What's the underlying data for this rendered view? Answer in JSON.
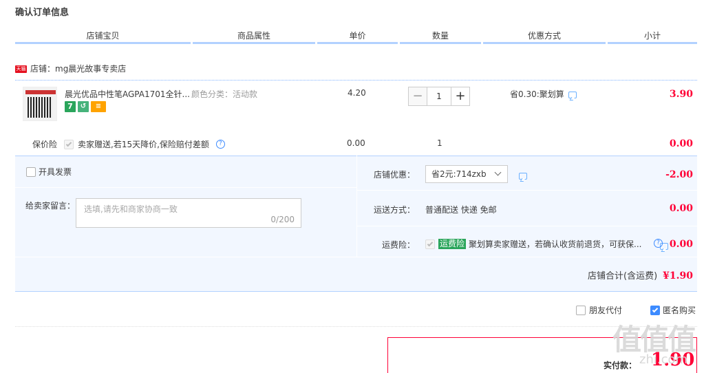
{
  "page_title": "确认订单信息",
  "columns": [
    "店铺宝贝",
    "商品属性",
    "单价",
    "数量",
    "优惠方式",
    "小计"
  ],
  "shop": {
    "tmall_label": "天猫",
    "name": "店铺：mg晨光故事专卖店"
  },
  "item": {
    "name": "晨光优品中性笔AGPA1701全针...",
    "attr": "颜色分类：活动款",
    "price": "4.20",
    "quantity": "1",
    "discount": "省0.30:聚划算",
    "subtotal": "3.90",
    "badges": [
      "7",
      "↺",
      "≡"
    ]
  },
  "insurance": {
    "label": "保价险",
    "desc": "卖家赠送,若15天降价,保险赔付差额",
    "price": "0.00",
    "qty": "1",
    "subtotal": "0.00"
  },
  "invoice_label": "开具发票",
  "memo": {
    "label": "给卖家留言：",
    "placeholder": "选填,请先和商家协商一致",
    "counter": "0/200"
  },
  "shop_discount": {
    "label": "店铺优惠：",
    "selected": "省2元:714zxb",
    "amount": "-2.00"
  },
  "shipping": {
    "label": "运送方式：",
    "value": "普通配送 快递 免邮",
    "amount": "0.00"
  },
  "shipping_insurance": {
    "label": "运费险：",
    "badge": "运费险",
    "desc": "聚划算卖家赠送，若确认收货前退货，可获保...",
    "amount": "0.00"
  },
  "shop_total": {
    "label": "店铺合计(含运费)",
    "amount": "¥1.90"
  },
  "options": {
    "friend_pay": "朋友代付",
    "anonymous": "匿名购买"
  },
  "pay": {
    "label": "实付款：",
    "amount": "1.90"
  },
  "watermark": {
    "text": "值值值",
    "sub": "zhi.com"
  },
  "colors": {
    "accent_red": "#ff0036",
    "blue_line": "#b2d1ff",
    "panel_bg": "#f2f7ff"
  }
}
